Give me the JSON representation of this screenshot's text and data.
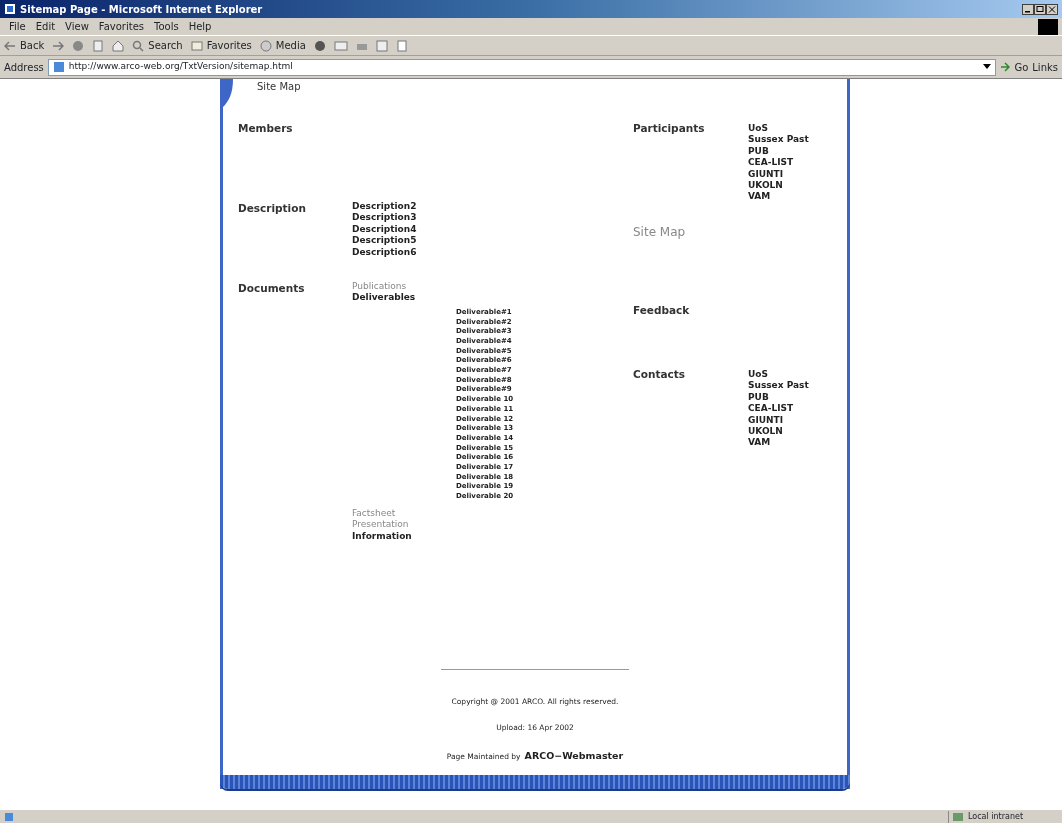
{
  "window": {
    "title": "Sitemap Page - Microsoft Internet Explorer"
  },
  "menu": [
    "File",
    "Edit",
    "View",
    "Favorites",
    "Tools",
    "Help"
  ],
  "toolbar": {
    "back": "Back",
    "search": "Search",
    "favorites": "Favorites",
    "media": "Media"
  },
  "address": {
    "label": "Address",
    "value": "http://www.arco-web.org/TxtVersion/sitemap.html",
    "go": "Go",
    "links": "Links"
  },
  "page": {
    "header": "Site Map",
    "left": [
      {
        "title": "Members"
      },
      {
        "title": "Description",
        "items": [
          {
            "label": "Description2",
            "visited": false
          },
          {
            "label": "Description3",
            "visited": false
          },
          {
            "label": "Description4",
            "visited": false
          },
          {
            "label": "Description5",
            "visited": false
          },
          {
            "label": "Description6",
            "visited": false
          }
        ]
      },
      {
        "title": "Documents",
        "items": [
          {
            "label": "Publications",
            "visited": true
          },
          {
            "label": "Deliverables",
            "visited": false,
            "children": [
              {
                "label": "Deliverable#1",
                "visited": false
              },
              {
                "label": "Deliverable#2",
                "visited": false
              },
              {
                "label": "Deliverable#3",
                "visited": false
              },
              {
                "label": "Deliverable#4",
                "visited": false
              },
              {
                "label": "Deliverable#5",
                "visited": false
              },
              {
                "label": "Deliverable#6",
                "visited": false
              },
              {
                "label": "Deliverable#7",
                "visited": false
              },
              {
                "label": "Deliverable#8",
                "visited": false
              },
              {
                "label": "Deliverable#9",
                "visited": false
              },
              {
                "label": "Deliverable 10",
                "visited": false
              },
              {
                "label": "Deliverable 11",
                "visited": false
              },
              {
                "label": "Deliverable 12",
                "visited": false
              },
              {
                "label": "Deliverable 13",
                "visited": false
              },
              {
                "label": "Deliverable 14",
                "visited": false
              },
              {
                "label": "Deliverable 15",
                "visited": false
              },
              {
                "label": "Deliverable 16",
                "visited": false
              },
              {
                "label": "Deliverable 17",
                "visited": false
              },
              {
                "label": "Deliverable 18",
                "visited": false
              },
              {
                "label": "Deliverable 19",
                "visited": false
              },
              {
                "label": "Deliverable 20",
                "visited": false
              }
            ]
          },
          {
            "label": "Factsheet",
            "visited": true
          },
          {
            "label": "Presentation",
            "visited": true
          },
          {
            "label": "Information",
            "visited": false
          }
        ]
      }
    ],
    "right": [
      {
        "title": "Participants",
        "visited": false,
        "items": [
          {
            "label": "UoS",
            "visited": false
          },
          {
            "label": "Sussex Past",
            "visited": false
          },
          {
            "label": "PUB",
            "visited": false
          },
          {
            "label": "CEA-LIST",
            "visited": false
          },
          {
            "label": "GIUNTI",
            "visited": false
          },
          {
            "label": "UKOLN",
            "visited": false
          },
          {
            "label": "VAM",
            "visited": false
          }
        ]
      },
      {
        "title": "Site Map",
        "visited": true
      },
      {
        "title": "Feedback",
        "visited": false
      },
      {
        "title": "Contacts",
        "visited": false,
        "items": [
          {
            "label": "UoS",
            "visited": false
          },
          {
            "label": "Sussex Past",
            "visited": false
          },
          {
            "label": "PUB",
            "visited": false
          },
          {
            "label": "CEA-LIST",
            "visited": false
          },
          {
            "label": "GIUNTI",
            "visited": false
          },
          {
            "label": "UKOLN",
            "visited": false
          },
          {
            "label": "VAM",
            "visited": false
          }
        ]
      }
    ],
    "copyright": "Copyright @ 2001 ARCO. All rights reserved.",
    "update": "Upload: 16 Apr 2002",
    "maintained": "Page Maintained by",
    "webmaster": "ARCO−Webmaster"
  },
  "status_bar": {
    "zone": "Local intranet"
  }
}
